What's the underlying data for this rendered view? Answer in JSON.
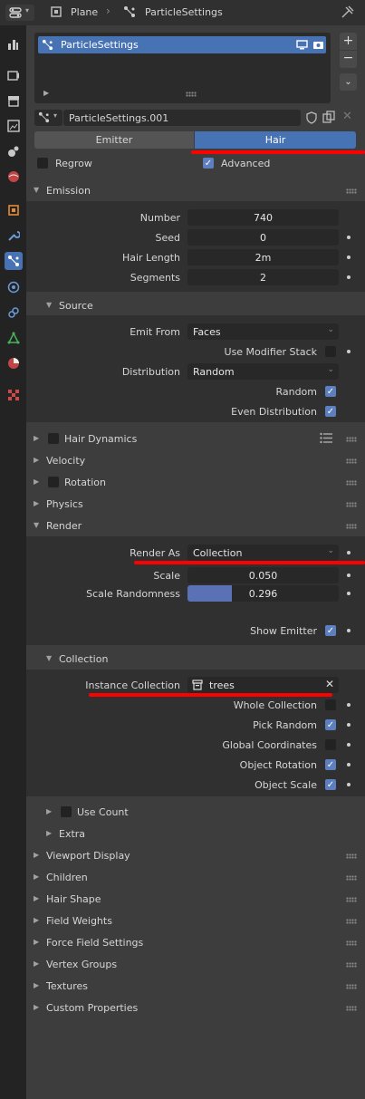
{
  "header": {
    "object_name": "Plane",
    "settings_name": "ParticleSettings"
  },
  "particle_list": {
    "item_label": "ParticleSettings"
  },
  "datablock": {
    "name": "ParticleSettings.001"
  },
  "type_tabs": {
    "emitter": "Emitter",
    "hair": "Hair",
    "active": "Hair"
  },
  "options": {
    "regrow": "Regrow",
    "advanced": "Advanced"
  },
  "emission": {
    "title": "Emission",
    "number_label": "Number",
    "number_value": "740",
    "seed_label": "Seed",
    "seed_value": "0",
    "hair_length_label": "Hair Length",
    "hair_length_value": "2m",
    "segments_label": "Segments",
    "segments_value": "2"
  },
  "source": {
    "title": "Source",
    "emit_from_label": "Emit From",
    "emit_from_value": "Faces",
    "use_modifier_stack_label": "Use Modifier Stack",
    "distribution_label": "Distribution",
    "distribution_value": "Random",
    "random_label": "Random",
    "even_distribution_label": "Even Distribution"
  },
  "panels": {
    "hair_dynamics": "Hair Dynamics",
    "velocity": "Velocity",
    "rotation": "Rotation",
    "physics": "Physics",
    "render": "Render"
  },
  "render": {
    "render_as_label": "Render As",
    "render_as_value": "Collection",
    "scale_label": "Scale",
    "scale_value": "0.050",
    "scale_randomness_label": "Scale Randomness",
    "scale_randomness_value": "0.296",
    "scale_randomness_fraction": 0.296,
    "show_emitter_label": "Show Emitter"
  },
  "collection": {
    "title": "Collection",
    "instance_collection_label": "Instance Collection",
    "instance_collection_value": "trees",
    "whole_collection_label": "Whole Collection",
    "pick_random_label": "Pick Random",
    "global_coordinates_label": "Global Coordinates",
    "object_rotation_label": "Object Rotation",
    "object_scale_label": "Object Scale",
    "use_count_label": "Use Count",
    "extra_label": "Extra"
  },
  "bottom_panels": {
    "viewport_display": "Viewport Display",
    "children": "Children",
    "hair_shape": "Hair Shape",
    "field_weights": "Field Weights",
    "force_field_settings": "Force Field Settings",
    "vertex_groups": "Vertex Groups",
    "textures": "Textures",
    "custom_properties": "Custom Properties"
  },
  "colors": {
    "accent": "#4772b3",
    "checkbox_on": "#5d7fc0",
    "annotation": "#ff0000"
  },
  "icons": {
    "sidebar": [
      "tool",
      "render",
      "output",
      "view-layer",
      "scene",
      "world",
      "object",
      "modifier",
      "particles",
      "physics",
      "constraints",
      "data",
      "material",
      "texture"
    ]
  }
}
